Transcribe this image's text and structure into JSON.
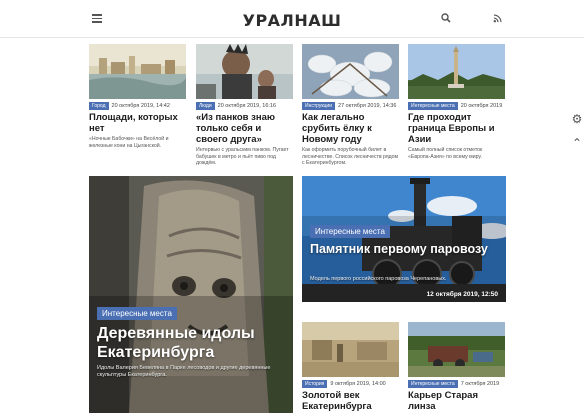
{
  "header": {
    "logo": "УРАЛНАШ",
    "menu_icon": "hamburger-icon",
    "search_icon": "search-icon",
    "rss_icon": "rss-icon"
  },
  "side_icons": [
    "gear-icon",
    "chevron-up-icon"
  ],
  "top_cards": [
    {
      "category": "Город",
      "date": "20 октября 2019, 14:42",
      "title": "Площади, которых нет",
      "desc": "«Ночные Бабочки» на Весёлой и железные кони на Цыганской."
    },
    {
      "category": "Люди",
      "date": "20 октября 2019, 16:16",
      "title": "«Из панков знаю только себя и своего друга»",
      "desc": "Интервью с уральским панком. Пугает бабушек в метро и пьёт пиво под дождём."
    },
    {
      "category": "Инструкции",
      "date": "27 октября 2019, 14:36",
      "title": "Как легально срубить ёлку к Новому году",
      "desc": "Как оформить порубочный билет в лесничестве. Список лесничеств рядом с Екатеринбургом."
    },
    {
      "category": "Интересные места",
      "date": "20 октября 2019",
      "title": "Где проходит граница Европы и Азии",
      "desc": "Самый полный список отметок «Европа-Азия» по всему миру."
    }
  ],
  "big_left": {
    "category": "Интересные места",
    "title": "Деревянные идолы Екатеринбурга",
    "desc": "Идолы Валерия Бевеляна в Парке лесоводов и другие деревянные скульптуры Екатеринбурга."
  },
  "big_right": {
    "category": "Интересные места",
    "title": "Памятник первому паровозу",
    "desc": "Модель первого российского паровоза Черепановых.",
    "date": "12 октября 2019, 12:50"
  },
  "bottom_cards": [
    {
      "category": "История",
      "date": "9 октября 2019, 14:00",
      "title": "Золотой век Екатеринбурга"
    },
    {
      "category": "Интересные места",
      "date": "7 октября 2019",
      "title": "Карьер Старая линза"
    }
  ],
  "colors": {
    "accent": "#4a6fb3",
    "text": "#1c1c1c"
  }
}
